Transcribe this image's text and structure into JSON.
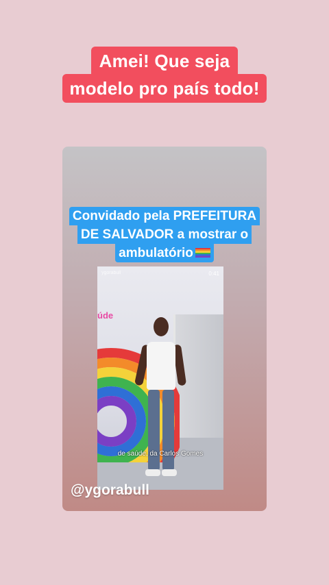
{
  "caption": {
    "line1": "Amei! Que seja",
    "line2": "modelo pro país todo!"
  },
  "story": {
    "text_lines": [
      "Convidado pela PREFEITURA",
      "DE SALVADOR a mostrar o",
      "ambulatório"
    ],
    "flag_icon": "rainbow-flag-icon",
    "video": {
      "username_overlay": "ygorabull",
      "time": "0:41",
      "wall_text": "úde",
      "subtitle": "de saúde, da Carlos Gomes"
    },
    "handle": "@ygorabull"
  },
  "colors": {
    "background": "#e8ccd2",
    "caption_bg": "#f24e5e",
    "blue_bg": "#2f9ff0"
  }
}
